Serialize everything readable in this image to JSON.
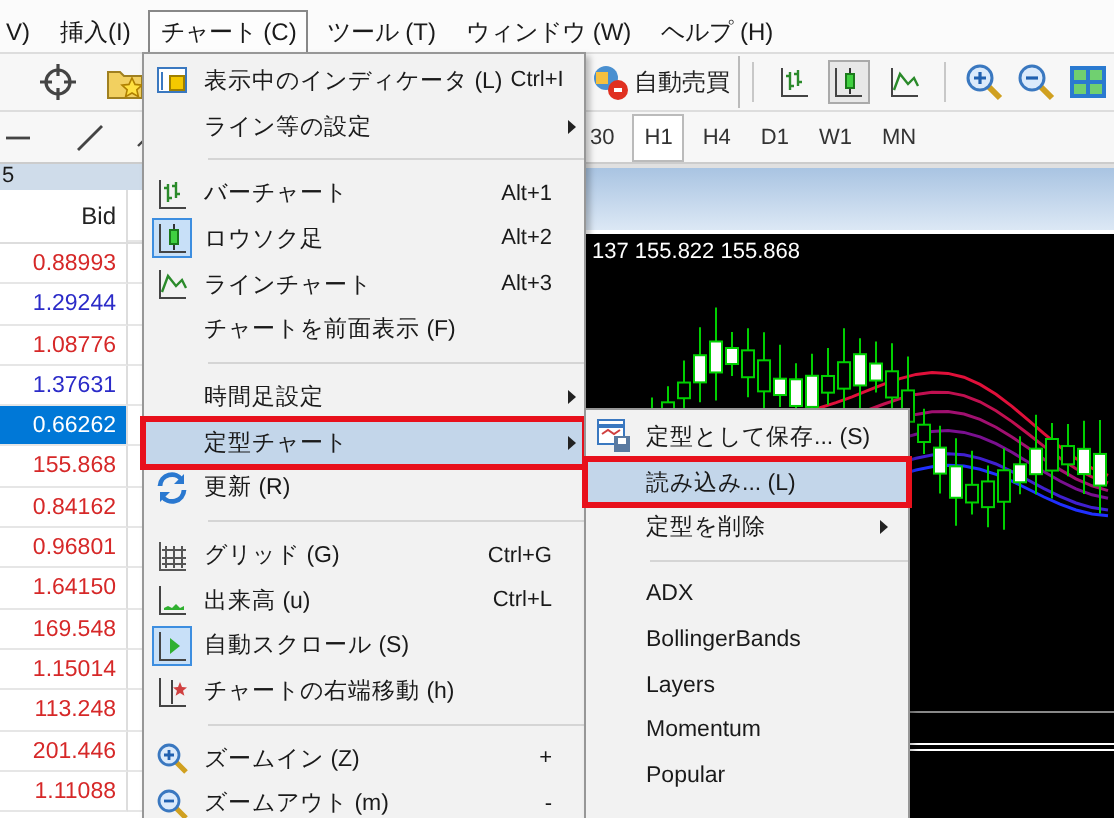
{
  "menubar": [
    {
      "label": "V)",
      "selected": false
    },
    {
      "label": "挿入(I)",
      "selected": false
    },
    {
      "label": "チャート (C)",
      "selected": true
    },
    {
      "label": "ツール (T)",
      "selected": false
    },
    {
      "label": "ウィンドウ (W)",
      "selected": false
    },
    {
      "label": "ヘルプ (H)",
      "selected": false
    }
  ],
  "toolbar": {
    "autotrade_label": "自動売買",
    "chart_types": [
      {
        "selected": false
      },
      {
        "selected": true
      },
      {
        "selected": false
      }
    ]
  },
  "timeframes": [
    {
      "label": "30",
      "selected": false
    },
    {
      "label": "H1",
      "selected": true
    },
    {
      "label": "H4",
      "selected": false
    },
    {
      "label": "D1",
      "selected": false
    },
    {
      "label": "W1",
      "selected": false
    },
    {
      "label": "MN",
      "selected": false
    }
  ],
  "market_watch": {
    "header": "5",
    "column": "Bid",
    "rows": [
      {
        "bid": "0.88993",
        "color": "#d62828",
        "selected": false
      },
      {
        "bid": "1.29244",
        "color": "#2b2bc8",
        "selected": false
      },
      {
        "bid": "1.08776",
        "color": "#d62828",
        "selected": false
      },
      {
        "bid": "1.37631",
        "color": "#2b2bc8",
        "selected": false
      },
      {
        "bid": "0.66262",
        "selected": true
      },
      {
        "bid": "155.868",
        "color": "#d62828",
        "selected": false
      },
      {
        "bid": "0.84162",
        "color": "#d62828",
        "selected": false
      },
      {
        "bid": "0.96801",
        "color": "#d62828",
        "selected": false
      },
      {
        "bid": "1.64150",
        "color": "#d62828",
        "selected": false
      },
      {
        "bid": "169.548",
        "color": "#d62828",
        "selected": false
      },
      {
        "bid": "1.15014",
        "color": "#d62828",
        "selected": false
      },
      {
        "bid": "113.248",
        "color": "#d62828",
        "selected": false
      },
      {
        "bid": "201.446",
        "color": "#d62828",
        "selected": false
      },
      {
        "bid": "1.11088",
        "color": "#d62828",
        "selected": false
      }
    ]
  },
  "chart": {
    "price_text": "137 155.822 155.868"
  },
  "chart_menu": {
    "items": [
      {
        "kind": "item",
        "label": "表示中のインディケータ (L)",
        "shortcut": "Ctrl+I",
        "submenu": false,
        "checked": false,
        "highlighted": false,
        "marked": false
      },
      {
        "kind": "item",
        "label": "ライン等の設定",
        "submenu": true,
        "checked": false,
        "highlighted": false,
        "marked": false
      },
      {
        "kind": "separator"
      },
      {
        "kind": "item",
        "label": "バーチャート",
        "shortcut": "Alt+1",
        "submenu": false,
        "checked": false,
        "highlighted": false,
        "marked": false
      },
      {
        "kind": "item",
        "label": "ロウソク足",
        "shortcut": "Alt+2",
        "submenu": false,
        "checked": true,
        "highlighted": false,
        "marked": false
      },
      {
        "kind": "item",
        "label": "ラインチャート",
        "shortcut": "Alt+3",
        "submenu": false,
        "checked": false,
        "highlighted": false,
        "marked": false
      },
      {
        "kind": "item",
        "label": "チャートを前面表示 (F)",
        "submenu": false,
        "checked": false,
        "highlighted": false,
        "marked": false
      },
      {
        "kind": "separator"
      },
      {
        "kind": "item",
        "label": "時間足設定",
        "submenu": true,
        "checked": false,
        "highlighted": false,
        "marked": false
      },
      {
        "kind": "item",
        "label": "定型チャート",
        "submenu": true,
        "checked": false,
        "highlighted": true,
        "marked": true
      },
      {
        "kind": "item",
        "label": "更新 (R)",
        "submenu": false,
        "checked": false,
        "highlighted": false,
        "marked": false
      },
      {
        "kind": "separator"
      },
      {
        "kind": "item",
        "label": "グリッド (G)",
        "shortcut": "Ctrl+G",
        "submenu": false,
        "checked": false,
        "highlighted": false,
        "marked": false
      },
      {
        "kind": "item",
        "label": "出来高 (u)",
        "shortcut": "Ctrl+L",
        "submenu": false,
        "checked": false,
        "highlighted": false,
        "marked": false
      },
      {
        "kind": "item",
        "label": "自動スクロール (S)",
        "submenu": false,
        "checked": true,
        "highlighted": false,
        "marked": false
      },
      {
        "kind": "item",
        "label": "チャートの右端移動 (h)",
        "submenu": false,
        "checked": false,
        "highlighted": false,
        "marked": false
      },
      {
        "kind": "separator"
      },
      {
        "kind": "item",
        "label": "ズームイン (Z)",
        "shortcut": "+",
        "submenu": false,
        "checked": false,
        "highlighted": false,
        "marked": false
      },
      {
        "kind": "item",
        "label": "ズームアウト (m)",
        "shortcut": "-",
        "submenu": false,
        "checked": false,
        "highlighted": false,
        "marked": false
      }
    ]
  },
  "template_submenu": {
    "items": [
      {
        "kind": "item",
        "label": "定型として保存... (S)",
        "submenu": false,
        "highlighted": false,
        "marked": false
      },
      {
        "kind": "item",
        "label": "読み込み... (L)",
        "submenu": false,
        "highlighted": true,
        "marked": true
      },
      {
        "kind": "item",
        "label": "定型を削除",
        "submenu": true,
        "highlighted": false,
        "marked": false
      },
      {
        "kind": "separator"
      },
      {
        "kind": "item",
        "label": "ADX",
        "submenu": false,
        "highlighted": false,
        "marked": false
      },
      {
        "kind": "item",
        "label": "BollingerBands",
        "submenu": false,
        "highlighted": false,
        "marked": false
      },
      {
        "kind": "item",
        "label": "Layers",
        "submenu": false,
        "highlighted": false,
        "marked": false
      },
      {
        "kind": "item",
        "label": "Momentum",
        "submenu": false,
        "highlighted": false,
        "marked": false
      },
      {
        "kind": "item",
        "label": "Popular",
        "submenu": false,
        "highlighted": false,
        "marked": false
      }
    ]
  }
}
